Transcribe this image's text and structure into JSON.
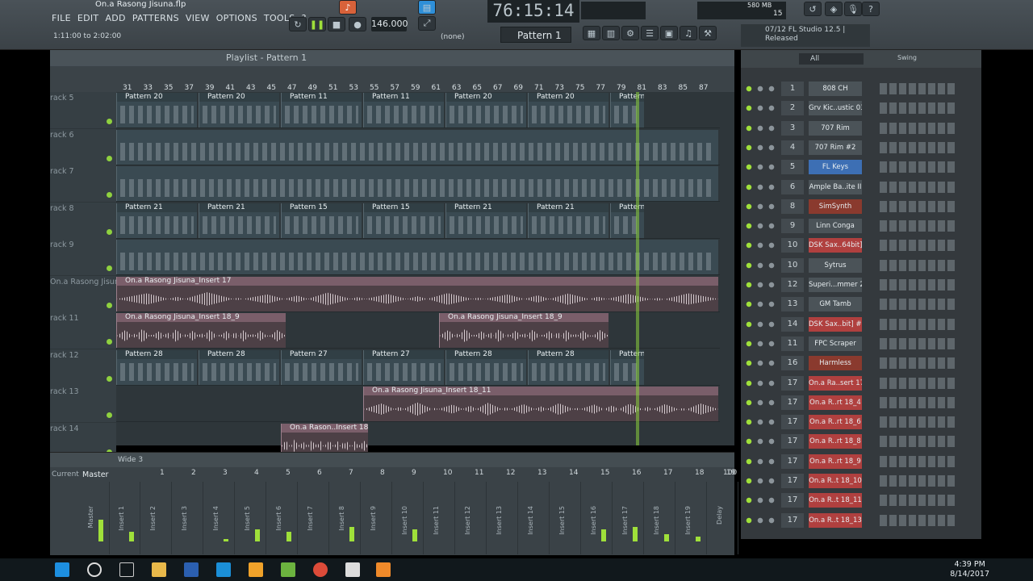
{
  "window": {
    "title": "On.a Rasong Jisuna.flp"
  },
  "menu": [
    "FILE",
    "EDIT",
    "ADD",
    "PATTERNS",
    "VIEW",
    "OPTIONS",
    "TOOLS",
    "?"
  ],
  "hint": "1:11:00 to 2:02:00",
  "transport": {
    "time": "76:15:14",
    "tempo": "146.000",
    "pattern": "Pattern 1",
    "snap": "(none)"
  },
  "info": {
    "version_line": "07/12  FL Studio 12.5 |",
    "status": "Released",
    "ram": "580 MB",
    "cpu": "15"
  },
  "playlist": {
    "title": "Playlist - Pattern 1",
    "ruler": [
      "31",
      "33",
      "35",
      "37",
      "39",
      "41",
      "43",
      "45",
      "47",
      "49",
      "51",
      "53",
      "55",
      "57",
      "59",
      "61",
      "63",
      "65",
      "67",
      "69",
      "71",
      "73",
      "75",
      "77",
      "79",
      "81",
      "83",
      "85",
      "87"
    ],
    "tracks": [
      {
        "label": "rack 5",
        "clips": [
          {
            "name": "Pattern 20"
          },
          {
            "name": "Pattern 20"
          },
          {
            "name": "Pattern 11"
          },
          {
            "name": "Pattern 11"
          },
          {
            "name": "Pattern 20"
          },
          {
            "name": "Pattern 20"
          },
          {
            "name": "Pattern 11"
          }
        ]
      },
      {
        "label": "rack 6",
        "clips": []
      },
      {
        "label": "rack 7",
        "clips": []
      },
      {
        "label": "rack 8",
        "clips": [
          {
            "name": "Pattern 21"
          },
          {
            "name": "Pattern 21"
          },
          {
            "name": "Pattern 15"
          },
          {
            "name": "Pattern 15"
          },
          {
            "name": "Pattern 21"
          },
          {
            "name": "Pattern 21"
          },
          {
            "name": "Pattern 15"
          }
        ]
      },
      {
        "label": "rack 9",
        "clips": []
      },
      {
        "label": "On.a Rasong Jisuna_Insert 17",
        "clips": [
          {
            "name": "On.a Rasong Jisuna_Insert 17"
          }
        ]
      },
      {
        "label": "rack 11",
        "clips": [
          {
            "name": "On.a Rasong Jisuna_Insert 18_9"
          },
          {
            "name": "On.a Rasong Jisuna_Insert 18_9"
          }
        ]
      },
      {
        "label": "rack 12",
        "clips": [
          {
            "name": "Pattern 28"
          },
          {
            "name": "Pattern 28"
          },
          {
            "name": "Pattern 27"
          },
          {
            "name": "Pattern 27"
          },
          {
            "name": "Pattern 28"
          },
          {
            "name": "Pattern 28"
          },
          {
            "name": "Pattern 27"
          }
        ]
      },
      {
        "label": "rack 13",
        "clips": [
          {
            "name": "On.a Rasong Jisuna_Insert 18_11"
          }
        ]
      },
      {
        "label": "rack 14",
        "clips": [
          {
            "name": "On.a Rason..Insert 18_10"
          }
        ]
      }
    ]
  },
  "mixer": {
    "title": "Wide 3",
    "current": "Current",
    "master": "Master",
    "numbers": [
      "1",
      "2",
      "3",
      "4",
      "5",
      "6",
      "7",
      "8",
      "9",
      "10",
      "11",
      "12",
      "13",
      "14",
      "15",
      "16",
      "17",
      "18",
      "19",
      "100"
    ],
    "strips": [
      {
        "name": "Master",
        "level": 0.45
      },
      {
        "name": "Insert 1",
        "level": 0.2
      },
      {
        "name": "Insert 2",
        "level": 0.0
      },
      {
        "name": "Insert 3",
        "level": 0.0
      },
      {
        "name": "Insert 4",
        "level": 0.05
      },
      {
        "name": "Insert 5",
        "level": 0.25
      },
      {
        "name": "Insert 6",
        "level": 0.2
      },
      {
        "name": "Insert 7",
        "level": 0.0
      },
      {
        "name": "Insert 8",
        "level": 0.3
      },
      {
        "name": "Insert 9",
        "level": 0.0
      },
      {
        "name": "Insert 10",
        "level": 0.25
      },
      {
        "name": "Insert 11",
        "level": 0.0
      },
      {
        "name": "Insert 12",
        "level": 0.0
      },
      {
        "name": "Insert 13",
        "level": 0.0
      },
      {
        "name": "Insert 14",
        "level": 0.0
      },
      {
        "name": "Insert 15",
        "level": 0.0
      },
      {
        "name": "Insert 16",
        "level": 0.25
      },
      {
        "name": "Insert 17",
        "level": 0.3
      },
      {
        "name": "Insert 18",
        "level": 0.15
      },
      {
        "name": "Insert 19",
        "level": 0.1
      },
      {
        "name": "Delay",
        "level": 0.0
      }
    ]
  },
  "channel_rack": {
    "filter": "All",
    "swing_label": "Swing",
    "channels": [
      {
        "num": "1",
        "name": "808 CH",
        "style": ""
      },
      {
        "num": "2",
        "name": "Grv Kic..ustic 03",
        "style": ""
      },
      {
        "num": "3",
        "name": "707 Rim",
        "style": ""
      },
      {
        "num": "4",
        "name": "707 Rim #2",
        "style": ""
      },
      {
        "num": "5",
        "name": "FL Keys",
        "style": "blue"
      },
      {
        "num": "6",
        "name": "Ample Ba..ite II",
        "style": ""
      },
      {
        "num": "8",
        "name": "SimSynth",
        "style": "sel"
      },
      {
        "num": "9",
        "name": "Linn Conga",
        "style": ""
      },
      {
        "num": "10",
        "name": "DSK Sax..64bit]",
        "style": "red"
      },
      {
        "num": "10",
        "name": "Sytrus",
        "style": ""
      },
      {
        "num": "12",
        "name": "Superi...mmer 2",
        "style": ""
      },
      {
        "num": "13",
        "name": "GM Tamb",
        "style": ""
      },
      {
        "num": "14",
        "name": "DSK Sax..bit] #2",
        "style": "red"
      },
      {
        "num": "11",
        "name": "FPC Scraper",
        "style": ""
      },
      {
        "num": "16",
        "name": "Harmless",
        "style": "sel"
      },
      {
        "num": "17",
        "name": "On.a Ra..sert 17",
        "style": "red"
      },
      {
        "num": "17",
        "name": "On.a R..rt 18_4",
        "style": "red"
      },
      {
        "num": "17",
        "name": "On.a R..rt 18_6",
        "style": "red"
      },
      {
        "num": "17",
        "name": "On.a R..rt 18_8",
        "style": "red"
      },
      {
        "num": "17",
        "name": "On.a R..rt 18_9",
        "style": "red"
      },
      {
        "num": "17",
        "name": "On.a R..t 18_10",
        "style": "red"
      },
      {
        "num": "17",
        "name": "On.a R..t 18_11",
        "style": "red"
      },
      {
        "num": "17",
        "name": "On.a R..t 18_13",
        "style": "red"
      }
    ]
  },
  "taskbar": {
    "time": "4:39 PM",
    "date": "8/14/2017"
  }
}
